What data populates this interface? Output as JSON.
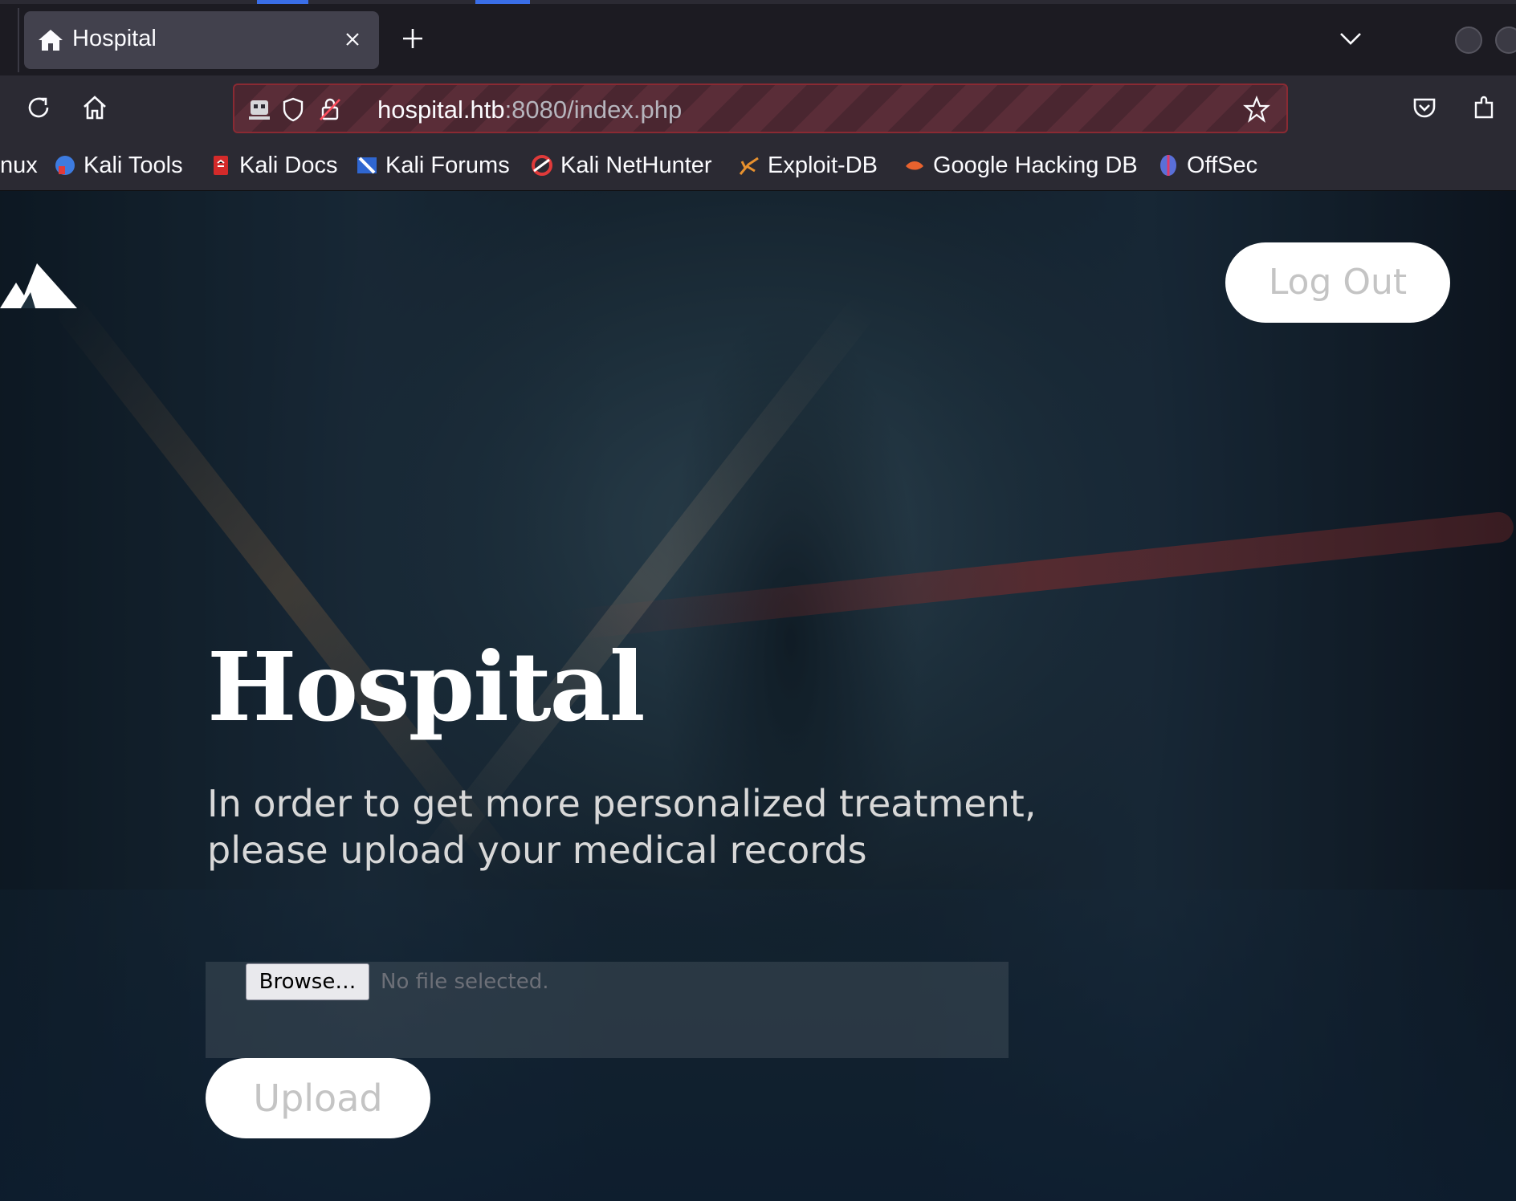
{
  "browser": {
    "tab": {
      "title": "Hospital",
      "favicon": "home-icon"
    },
    "url": {
      "host": "hospital.htb",
      "rest": ":8080/index.php"
    },
    "bookmarks": [
      {
        "label": "nux",
        "icon": "kali-linux-icon"
      },
      {
        "label": "Kali Tools",
        "icon": "kali-tools-icon"
      },
      {
        "label": "Kali Docs",
        "icon": "kali-docs-icon"
      },
      {
        "label": "Kali Forums",
        "icon": "kali-forums-icon"
      },
      {
        "label": "Kali NetHunter",
        "icon": "kali-nethunter-icon"
      },
      {
        "label": "Exploit-DB",
        "icon": "exploit-db-icon"
      },
      {
        "label": "Google Hacking DB",
        "icon": "ghdb-icon"
      },
      {
        "label": "OffSec",
        "icon": "offsec-icon"
      }
    ]
  },
  "page": {
    "logout_label": "Log Out",
    "heading": "Hospital",
    "subtitle": "In order to get more personalized treatment, please upload your medical records",
    "browse_label": "Browse…",
    "no_file_text": "No file selected.",
    "upload_label": "Upload"
  },
  "colors": {
    "browser_bg": "#1c1b22",
    "toolbar_bg": "#2b2a33",
    "urlbar_stripe": "#5a2d38",
    "button_bg": "#ffffff",
    "button_text": "#c4c4c4"
  }
}
